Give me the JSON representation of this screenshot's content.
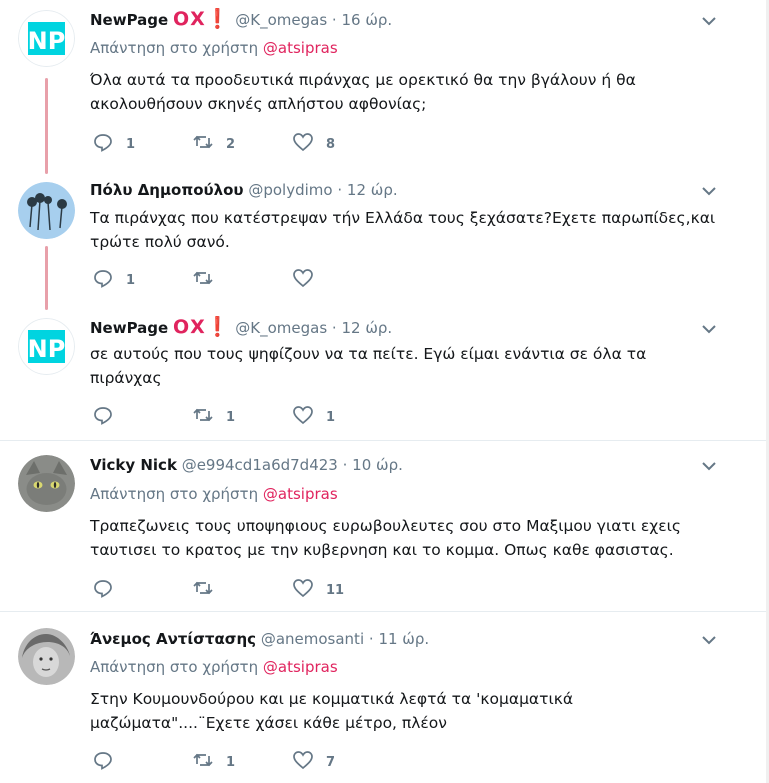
{
  "reply_prefix": "Απάντηση στο χρήστη",
  "tweets": [
    {
      "name": "NewPage",
      "badge": "ΟΧ❗",
      "handle": "@K_omegas",
      "time": "16 ώρ.",
      "reply_to": "@atsipras",
      "text": "Όλα αυτά τα προοδευτικά πιράνχας με ορεκτικό θα την βγάλουν ή θα ακολουθήσουν σκηνές απλήστου αφθονίας;",
      "replies": "1",
      "retweets": "2",
      "likes": "8"
    },
    {
      "name": "Πόλυ Δημοπούλου",
      "badge": "",
      "handle": "@polydimo",
      "time": "12 ώρ.",
      "reply_to": "",
      "text": "Τα πιράνχας που κατέστρεψαν τήν Ελλάδα τους ξεχάσατε?Εχετε παρωπίδες,και τρώτε πολύ σανό.",
      "replies": "1",
      "retweets": "",
      "likes": ""
    },
    {
      "name": "NewPage",
      "badge": "ΟΧ❗",
      "handle": "@K_omegas",
      "time": "12 ώρ.",
      "reply_to": "",
      "text": "σε αυτούς που τους ψηφίζουν να τα πείτε. Εγώ είμαι ενάντια σε όλα τα πιράνχας",
      "replies": "",
      "retweets": "1",
      "likes": "1"
    },
    {
      "name": "Vicky Nick",
      "badge": "",
      "handle": "@e994cd1a6d7d423",
      "time": "10 ώρ.",
      "reply_to": "@atsipras",
      "text": "Τραπεζωνεις τους υποψηφιους ευρωβουλευτες σου στο Μαξιμου γιατι εχεις ταυτισει το κρατος με την κυβερνηση και το κομμα. Οπως καθε φασιστας.",
      "replies": "",
      "retweets": "",
      "likes": "11"
    },
    {
      "name": "Άνεμος Αντίστασης",
      "badge": "",
      "handle": "@anemosanti",
      "time": "11 ώρ.",
      "reply_to": "@atsipras",
      "text": "Στην Κουμουνδούρου και με κομματικά λεφτά τα 'κομαματικά μαζώματα\"....¨Εχετε χάσει κάθε μέτρο, πλέον",
      "replies": "",
      "retweets": "1",
      "likes": "7"
    }
  ],
  "icons": {
    "reply": "reply-icon",
    "retweet": "retweet-icon",
    "like": "heart-icon",
    "menu": "chevron-down-icon"
  },
  "colors": {
    "accent": "#e0245e",
    "muted": "#657786",
    "thread_line": "#e8a0aa",
    "np_avatar": "#00d4e0"
  }
}
